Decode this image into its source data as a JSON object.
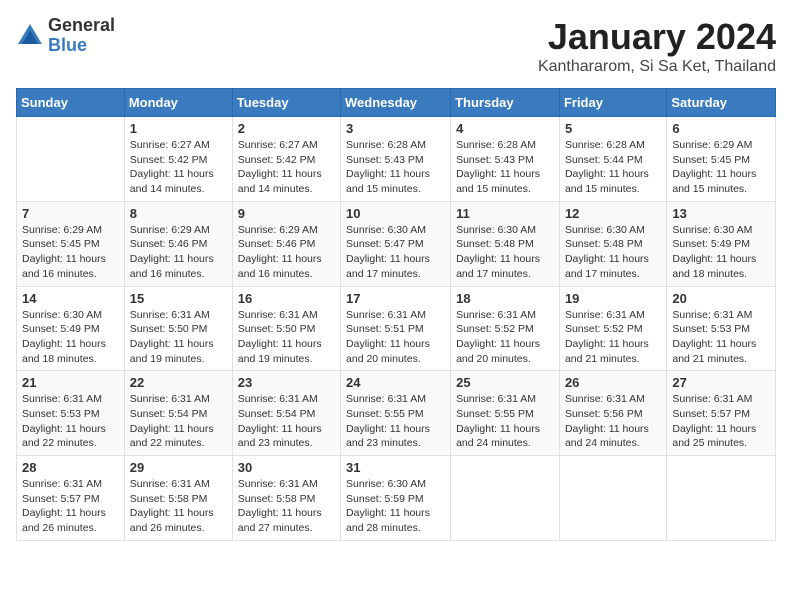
{
  "logo": {
    "general": "General",
    "blue": "Blue"
  },
  "title": "January 2024",
  "subtitle": "Kanthararom, Si Sa Ket, Thailand",
  "days_of_week": [
    "Sunday",
    "Monday",
    "Tuesday",
    "Wednesday",
    "Thursday",
    "Friday",
    "Saturday"
  ],
  "weeks": [
    [
      {
        "day": "",
        "info": ""
      },
      {
        "day": "1",
        "info": "Sunrise: 6:27 AM\nSunset: 5:42 PM\nDaylight: 11 hours\nand 14 minutes."
      },
      {
        "day": "2",
        "info": "Sunrise: 6:27 AM\nSunset: 5:42 PM\nDaylight: 11 hours\nand 14 minutes."
      },
      {
        "day": "3",
        "info": "Sunrise: 6:28 AM\nSunset: 5:43 PM\nDaylight: 11 hours\nand 15 minutes."
      },
      {
        "day": "4",
        "info": "Sunrise: 6:28 AM\nSunset: 5:43 PM\nDaylight: 11 hours\nand 15 minutes."
      },
      {
        "day": "5",
        "info": "Sunrise: 6:28 AM\nSunset: 5:44 PM\nDaylight: 11 hours\nand 15 minutes."
      },
      {
        "day": "6",
        "info": "Sunrise: 6:29 AM\nSunset: 5:45 PM\nDaylight: 11 hours\nand 15 minutes."
      }
    ],
    [
      {
        "day": "7",
        "info": "Sunrise: 6:29 AM\nSunset: 5:45 PM\nDaylight: 11 hours\nand 16 minutes."
      },
      {
        "day": "8",
        "info": "Sunrise: 6:29 AM\nSunset: 5:46 PM\nDaylight: 11 hours\nand 16 minutes."
      },
      {
        "day": "9",
        "info": "Sunrise: 6:29 AM\nSunset: 5:46 PM\nDaylight: 11 hours\nand 16 minutes."
      },
      {
        "day": "10",
        "info": "Sunrise: 6:30 AM\nSunset: 5:47 PM\nDaylight: 11 hours\nand 17 minutes."
      },
      {
        "day": "11",
        "info": "Sunrise: 6:30 AM\nSunset: 5:48 PM\nDaylight: 11 hours\nand 17 minutes."
      },
      {
        "day": "12",
        "info": "Sunrise: 6:30 AM\nSunset: 5:48 PM\nDaylight: 11 hours\nand 17 minutes."
      },
      {
        "day": "13",
        "info": "Sunrise: 6:30 AM\nSunset: 5:49 PM\nDaylight: 11 hours\nand 18 minutes."
      }
    ],
    [
      {
        "day": "14",
        "info": "Sunrise: 6:30 AM\nSunset: 5:49 PM\nDaylight: 11 hours\nand 18 minutes."
      },
      {
        "day": "15",
        "info": "Sunrise: 6:31 AM\nSunset: 5:50 PM\nDaylight: 11 hours\nand 19 minutes."
      },
      {
        "day": "16",
        "info": "Sunrise: 6:31 AM\nSunset: 5:50 PM\nDaylight: 11 hours\nand 19 minutes."
      },
      {
        "day": "17",
        "info": "Sunrise: 6:31 AM\nSunset: 5:51 PM\nDaylight: 11 hours\nand 20 minutes."
      },
      {
        "day": "18",
        "info": "Sunrise: 6:31 AM\nSunset: 5:52 PM\nDaylight: 11 hours\nand 20 minutes."
      },
      {
        "day": "19",
        "info": "Sunrise: 6:31 AM\nSunset: 5:52 PM\nDaylight: 11 hours\nand 21 minutes."
      },
      {
        "day": "20",
        "info": "Sunrise: 6:31 AM\nSunset: 5:53 PM\nDaylight: 11 hours\nand 21 minutes."
      }
    ],
    [
      {
        "day": "21",
        "info": "Sunrise: 6:31 AM\nSunset: 5:53 PM\nDaylight: 11 hours\nand 22 minutes."
      },
      {
        "day": "22",
        "info": "Sunrise: 6:31 AM\nSunset: 5:54 PM\nDaylight: 11 hours\nand 22 minutes."
      },
      {
        "day": "23",
        "info": "Sunrise: 6:31 AM\nSunset: 5:54 PM\nDaylight: 11 hours\nand 23 minutes."
      },
      {
        "day": "24",
        "info": "Sunrise: 6:31 AM\nSunset: 5:55 PM\nDaylight: 11 hours\nand 23 minutes."
      },
      {
        "day": "25",
        "info": "Sunrise: 6:31 AM\nSunset: 5:55 PM\nDaylight: 11 hours\nand 24 minutes."
      },
      {
        "day": "26",
        "info": "Sunrise: 6:31 AM\nSunset: 5:56 PM\nDaylight: 11 hours\nand 24 minutes."
      },
      {
        "day": "27",
        "info": "Sunrise: 6:31 AM\nSunset: 5:57 PM\nDaylight: 11 hours\nand 25 minutes."
      }
    ],
    [
      {
        "day": "28",
        "info": "Sunrise: 6:31 AM\nSunset: 5:57 PM\nDaylight: 11 hours\nand 26 minutes."
      },
      {
        "day": "29",
        "info": "Sunrise: 6:31 AM\nSunset: 5:58 PM\nDaylight: 11 hours\nand 26 minutes."
      },
      {
        "day": "30",
        "info": "Sunrise: 6:31 AM\nSunset: 5:58 PM\nDaylight: 11 hours\nand 27 minutes."
      },
      {
        "day": "31",
        "info": "Sunrise: 6:30 AM\nSunset: 5:59 PM\nDaylight: 11 hours\nand 28 minutes."
      },
      {
        "day": "",
        "info": ""
      },
      {
        "day": "",
        "info": ""
      },
      {
        "day": "",
        "info": ""
      }
    ]
  ]
}
